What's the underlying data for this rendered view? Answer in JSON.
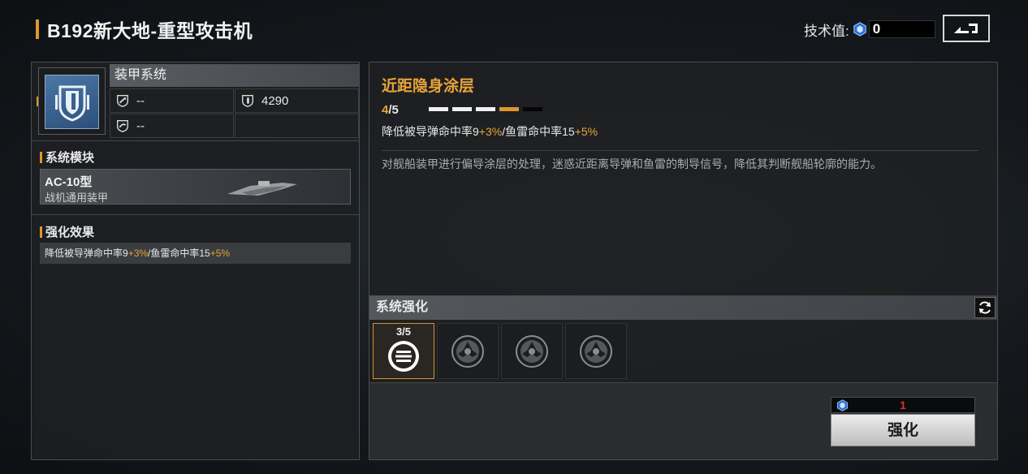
{
  "header": {
    "title": "B192新大地-重型攻击机",
    "tech_label": "技术值:",
    "tech_value": "0",
    "back_icon": "return-arrow-icon"
  },
  "left": {
    "system_name": "装甲系统",
    "stats": [
      {
        "icon": "missile-defense-icon",
        "value": "--"
      },
      {
        "icon": "armor-shield-icon",
        "value": "4290"
      },
      {
        "icon": "torpedo-defense-icon",
        "value": "--"
      }
    ],
    "module_section": "系统模块",
    "module_name": "AC-10型",
    "module_sub": "战机通用装甲",
    "effect_section": "强化效果",
    "effect_text_a": "降低被导弹命中率9",
    "effect_bonus_a": "+3%",
    "effect_text_b": "/鱼雷命中率15",
    "effect_bonus_b": "+5%"
  },
  "right": {
    "skill_name": "近距隐身涂层",
    "level_current": "4",
    "level_max": "/5",
    "level_value": 4,
    "level_total": 5,
    "effect_a": "降低被导弹命中率9",
    "bonus_a": "+3%",
    "effect_b": "/鱼雷命中率15",
    "bonus_b": "+5%",
    "description": "对舰船装甲进行偏导涂层的处理，迷惑近距离导弹和鱼雷的制导信号，降低其判断舰船轮廓的能力。",
    "enhance_title": "系统强化",
    "slot_active_count": "3/5",
    "cost_value": "1",
    "enhance_button": "强化"
  },
  "colors": {
    "accent": "#e0962c",
    "highlight": "#e8a43a",
    "cost": "#e03030"
  }
}
